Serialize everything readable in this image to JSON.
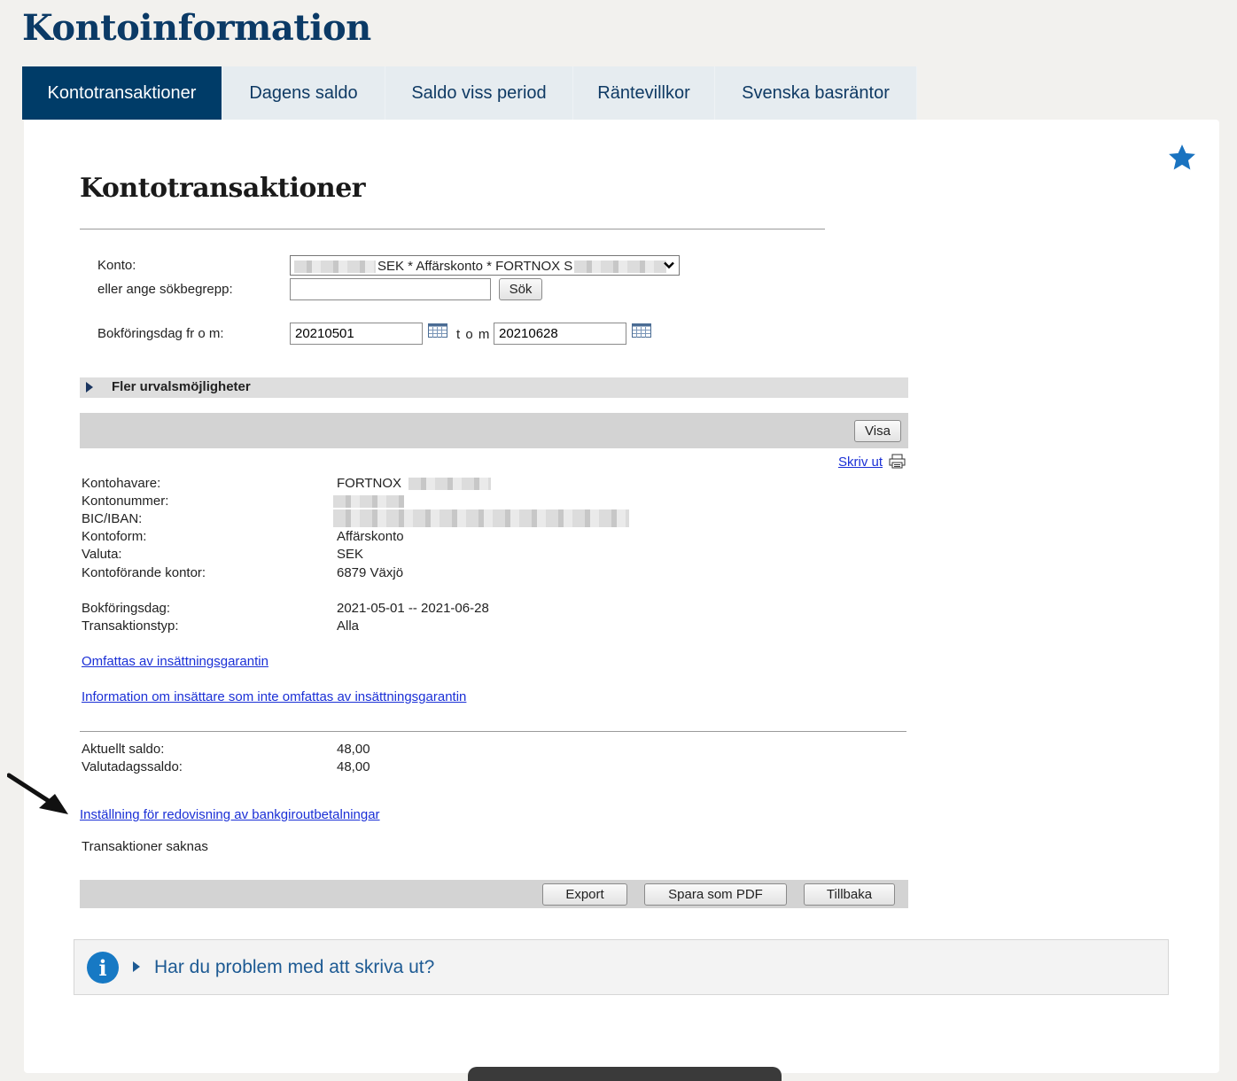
{
  "header": {
    "title": "Kontoinformation"
  },
  "tabs": [
    {
      "label": "Kontotransaktioner",
      "active": true
    },
    {
      "label": "Dagens saldo"
    },
    {
      "label": "Saldo viss period"
    },
    {
      "label": "Räntevillkor"
    },
    {
      "label": "Svenska basräntor"
    }
  ],
  "section": {
    "title": "Kontotransaktioner"
  },
  "form": {
    "konto_label": "Konto:",
    "konto_value_visible": "SEK * Affärskonto * FORTNOX",
    "konto_value_suffix": "S",
    "sok_label": "eller ange sökbegrepp:",
    "sok_value": "",
    "sok_button": "Sök",
    "bokf_label": "Bokföringsdag fr o m:",
    "date_from": "20210501",
    "tom_label": "t o m",
    "date_to": "20210628"
  },
  "more_options": {
    "label": "Fler urvalsmöjligheter"
  },
  "visa_button": "Visa",
  "print_link": "Skriv ut",
  "account_info": {
    "rows": [
      {
        "label": "Kontohavare:",
        "value": "FORTNOX"
      },
      {
        "label": "Kontonummer:",
        "value": ""
      },
      {
        "label": "BIC/IBAN:",
        "value": ""
      },
      {
        "label": "Kontoform:",
        "value": "Affärskonto"
      },
      {
        "label": "Valuta:",
        "value": "SEK"
      },
      {
        "label": "Kontoförande kontor:",
        "value": "6879 Växjö"
      }
    ],
    "rows2": [
      {
        "label": "Bokföringsdag:",
        "value": "2021-05-01 -- 2021-06-28"
      },
      {
        "label": "Transaktionstyp:",
        "value": "Alla"
      }
    ]
  },
  "links": {
    "guarantee": "Omfattas av insättningsgarantin",
    "guarantee_info": "Information om insättare som inte omfattas av insättningsgarantin",
    "bankgiro": "Inställning för redovisning av bankgiroutbetalningar"
  },
  "balances": [
    {
      "label": "Aktuellt saldo:",
      "value": "48,00"
    },
    {
      "label": "Valutadagssaldo:",
      "value": "48,00"
    }
  ],
  "no_transactions": "Transaktioner saknas",
  "actions": {
    "export": "Export",
    "pdf": "Spara som PDF",
    "back": "Tillbaka"
  },
  "help": {
    "text": "Har du problem med att skriva ut?"
  },
  "colors": {
    "brand": "#003c68",
    "link": "#1a2fd6",
    "info": "#1779c4"
  }
}
